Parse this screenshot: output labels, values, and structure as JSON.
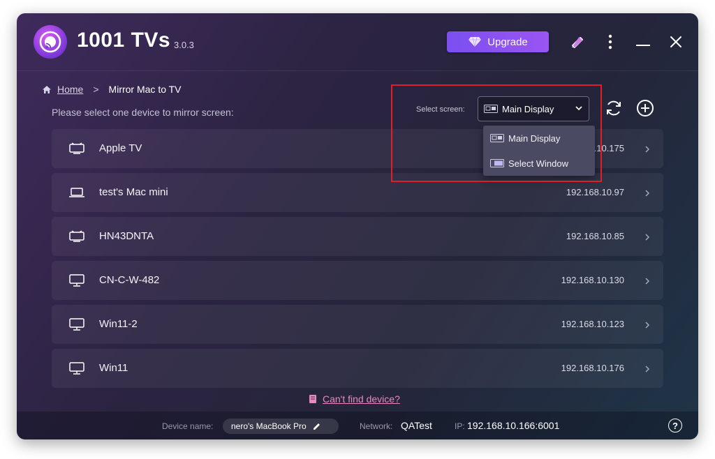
{
  "app": {
    "title": "1001 TVs",
    "version": "3.0.3",
    "upgrade_label": "Upgrade"
  },
  "icons": {
    "logo": "cast-logo-icon",
    "upgrade": "diamond-icon",
    "theme": "pencil-ruler-icon",
    "more": "more-vertical-icon",
    "minimize": "minimize-icon",
    "close": "close-icon",
    "home": "home-icon",
    "refresh": "refresh-icon",
    "add": "plus-circle-icon",
    "help": "help-icon"
  },
  "breadcrumb": {
    "home": "Home",
    "separator": ">",
    "current": "Mirror Mac to TV"
  },
  "prompt": "Please select one device to mirror screen:",
  "select_screen": {
    "label": "Select screen:",
    "selected": "Main Display",
    "options": [
      "Main Display",
      "Select Window"
    ]
  },
  "devices": [
    {
      "name": "Apple TV",
      "ip": ".10.175",
      "type": "tv"
    },
    {
      "name": "test's Mac mini",
      "ip": "192.168.10.97",
      "type": "laptop"
    },
    {
      "name": "HN43DNTA",
      "ip": "192.168.10.85",
      "type": "tv"
    },
    {
      "name": "CN-C-W-482",
      "ip": "192.168.10.130",
      "type": "monitor"
    },
    {
      "name": "Win11-2",
      "ip": "192.168.10.123",
      "type": "monitor"
    },
    {
      "name": "Win11",
      "ip": "192.168.10.176",
      "type": "monitor"
    }
  ],
  "cant_find": "Can't find device?",
  "footer": {
    "device_name_label": "Device name:",
    "device_name": "nero's MacBook Pro",
    "network_label": "Network:",
    "network": "QATest",
    "ip_label": "IP:",
    "ip": "192.168.10.166:6001",
    "help": "?"
  },
  "colors": {
    "accent": "#8a52f2",
    "link_pink": "#e889c4",
    "highlight_red": "#e01e24"
  }
}
